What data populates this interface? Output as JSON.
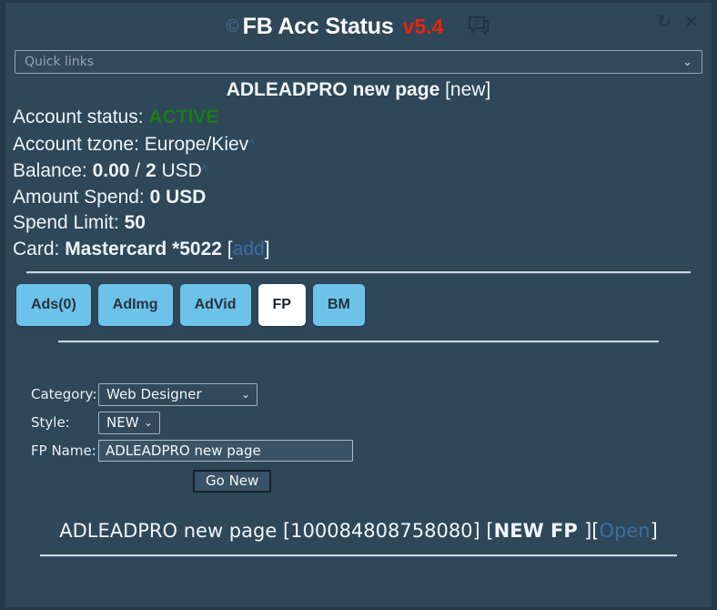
{
  "window": {
    "title": "FB Acc Status",
    "version": "v5.4",
    "copyright_mark": "©",
    "help_icon": "help-speech-bubble-icon",
    "refresh_label": "↻",
    "close_label": "✕"
  },
  "quick_links": {
    "placeholder": "Quick links",
    "caret": "⌄"
  },
  "page": {
    "title_main": "ADLEADPRO new page",
    "title_tag": " [new]"
  },
  "account": {
    "status_label": "Account status: ",
    "status_value": "ACTIVE",
    "tzone_label": "Account tzone: ",
    "tzone_value": "Europe/Kiev",
    "tzone_caret": "^",
    "balance_label": "Balance: ",
    "balance_value": "0.00",
    "balance_sep": " / ",
    "balance_limit": "2",
    "balance_currency": " USD",
    "balance_caret": "^",
    "spend_label": "Amount Spend:  ",
    "spend_value": "0 USD",
    "spend_limit_label": "Spend Limit: ",
    "spend_limit_value": "50",
    "card_label": "Card: ",
    "card_value": "Mastercard *5022",
    "card_bracket_open": " [",
    "card_add_link": "add",
    "card_bracket_close": "]"
  },
  "tabs": [
    {
      "label": "Ads(0)",
      "active": false
    },
    {
      "label": "AdImg",
      "active": false
    },
    {
      "label": "AdVid",
      "active": false
    },
    {
      "label": "FP",
      "active": true
    },
    {
      "label": "BM",
      "active": false
    }
  ],
  "form": {
    "category_label": "Category:",
    "category_value": "Web Designer",
    "style_label": "Style:",
    "style_value": "NEW",
    "fpname_label": "FP Name:",
    "fpname_value": "ADLEADPRO new page",
    "submit_label": "Go New",
    "caret": "⌄"
  },
  "result": {
    "name": "ADLEADPRO new page ",
    "id": "[100084808758080] ",
    "bracket_open": "[",
    "badge": "NEW FP ",
    "bracket_close": " ][",
    "open_link": "Open",
    "tail": "]"
  },
  "colors": {
    "background": "#2e4759",
    "tab_inactive": "#6cc2e9",
    "tab_active": "#ffffff",
    "accent_red": "#e8250e",
    "status_green": "#1c7a1c",
    "link_blue": "#3d6fa5",
    "divider": "#c9d7e1"
  }
}
